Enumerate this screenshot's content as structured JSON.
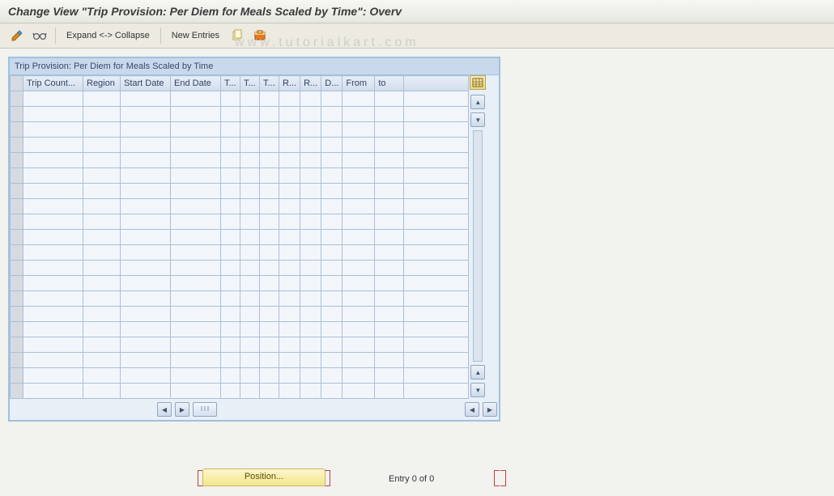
{
  "title": "Change View \"Trip Provision: Per Diem for Meals Scaled by Time\": Overv",
  "toolbar": {
    "expand_collapse_label": "Expand <-> Collapse",
    "new_entries_label": "New Entries"
  },
  "watermark": "www.tutorialkart.com",
  "panel": {
    "title": "Trip Provision: Per Diem for Meals Scaled by Time",
    "columns": [
      "Trip Count...",
      "Region",
      "Start Date",
      "End Date",
      "T...",
      "T...",
      "T...",
      "R...",
      "R...",
      "D...",
      "From",
      "to"
    ],
    "row_count": 20
  },
  "footer": {
    "position_label": "Position...",
    "entry_text": "Entry 0 of 0"
  }
}
